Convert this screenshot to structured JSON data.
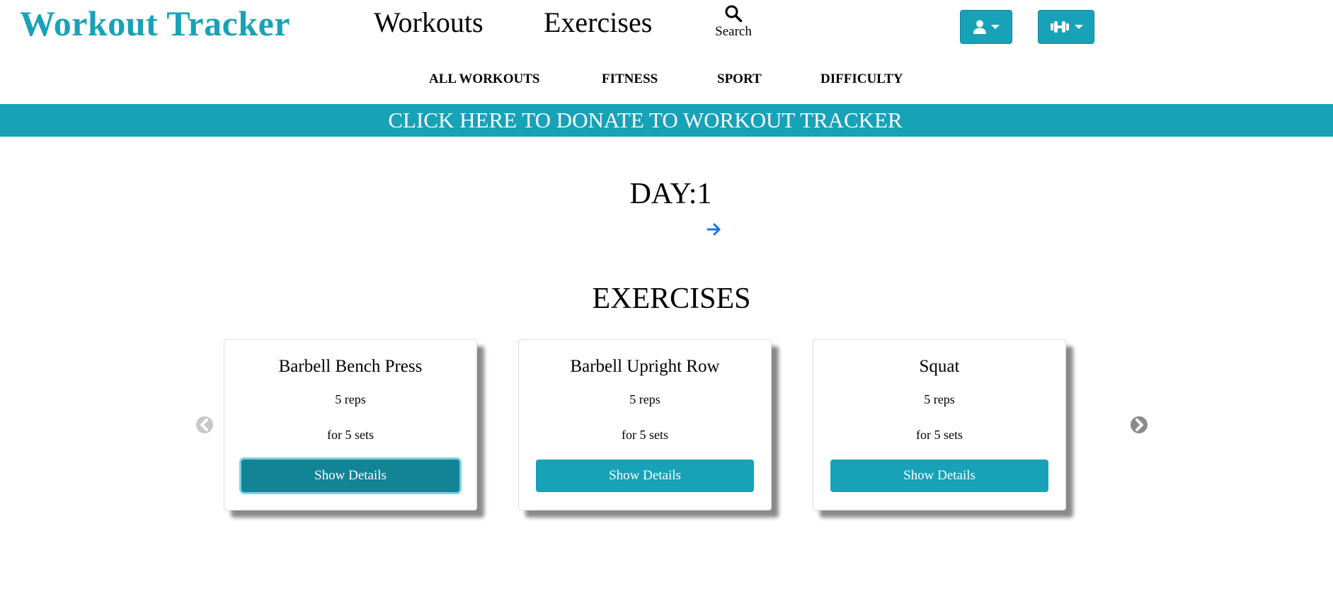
{
  "header": {
    "brand": "Workout Tracker",
    "nav": {
      "workouts": "Workouts",
      "exercises": "Exercises",
      "search": "Search"
    },
    "user_menu_icon": "user-icon",
    "gym_menu_icon": "dumbbell-icon"
  },
  "subnav": [
    "ALL WORKOUTS",
    "FITNESS",
    "SPORT",
    "DIFFICULTY"
  ],
  "donate_banner": "CLICK HERE TO DONATE TO WORKOUT TRACKER",
  "day": {
    "title": "DAY:1",
    "next_icon": "arrow-right-icon"
  },
  "exercises": {
    "title": "EXERCISES",
    "cards": [
      {
        "name": "Barbell Bench Press",
        "reps": "5 reps",
        "sets": "for 5 sets",
        "button": "Show Details"
      },
      {
        "name": "Barbell Upright Row",
        "reps": "5 reps",
        "sets": "for 5 sets",
        "button": "Show Details"
      },
      {
        "name": "Squat",
        "reps": "5 reps",
        "sets": "for 5 sets",
        "button": "Show Details"
      }
    ]
  },
  "colors": {
    "accent": "#17a2b8",
    "accent_dark": "#138496",
    "link": "#1a73e8"
  }
}
